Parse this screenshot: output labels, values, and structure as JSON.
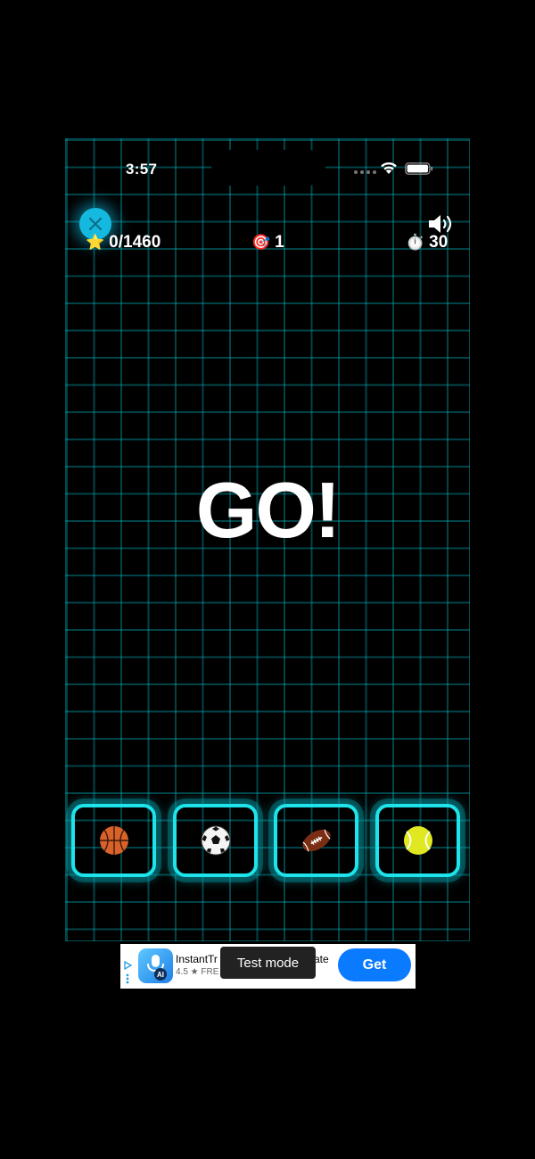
{
  "status_bar": {
    "time": "3:57"
  },
  "hud": {
    "score": "0/1460",
    "score_icon": "star-icon",
    "hits": "1",
    "hits_icon": "target-icon",
    "timer": "30",
    "timer_icon": "stopwatch-icon"
  },
  "game": {
    "start_text": "GO!",
    "balls": [
      "basketball",
      "soccer-ball",
      "american-football",
      "tennis-ball"
    ]
  },
  "ad": {
    "app_name_start": "InstantTr",
    "app_name_end": "ate",
    "rating": "4.5 ★ FRE",
    "test_mode": "Test mode",
    "get_label": "Get"
  },
  "colors": {
    "grid": "#00b4be",
    "slot_border": "#1fe3ea",
    "close_button": "#15b9df",
    "get_button": "#0a7aff"
  }
}
